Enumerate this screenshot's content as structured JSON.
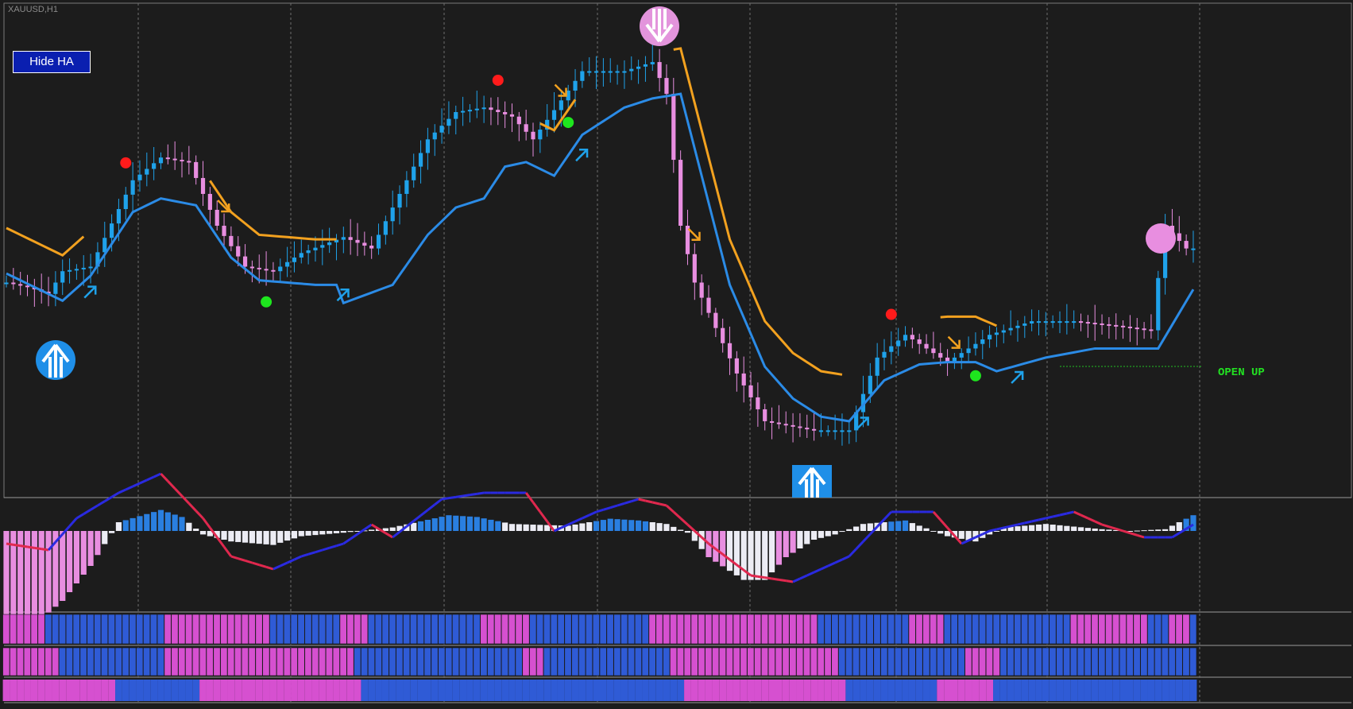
{
  "symbol_label": "XAUUSD,H1",
  "hide_button_label": "Hide HA",
  "open_label": "OPEN UP",
  "colors": {
    "background": "#1c1c1c",
    "grid": "#6e6e6e",
    "bull_candle": "#1fa2ea",
    "bear_candle": "#e88ee0",
    "trend_up_line": "#2b8be6",
    "trend_down_line": "#f2a11f",
    "signal_high_dot": "#ff1b1b",
    "signal_low_dot": "#1ee61e",
    "histo_blue": "#2a7fe0",
    "histo_white": "#ececf4",
    "histo_pink": "#e88ee0",
    "osc_blue": "#2a2ae0",
    "osc_red": "#e0284e",
    "strip_blue": "#2f5bd6",
    "strip_magenta": "#d650d0"
  },
  "icons": {
    "buy_circle": "up-arrow-circle-icon",
    "sell_circle": "down-arrow-circle-icon",
    "buy_square": "up-arrow-square-icon",
    "up_arrow": "diagonal-up-arrow-icon",
    "down_arrow": "diagonal-down-arrow-icon"
  },
  "chart_data": {
    "type": "candlestick",
    "title": "XAUUSD,H1",
    "bars": 170,
    "price_anchors": [
      [
        0,
        75
      ],
      [
        3,
        73
      ],
      [
        6,
        70
      ],
      [
        8,
        80
      ],
      [
        12,
        82
      ],
      [
        18,
        120
      ],
      [
        22,
        130
      ],
      [
        26,
        128
      ],
      [
        30,
        100
      ],
      [
        34,
        82
      ],
      [
        38,
        80
      ],
      [
        42,
        88
      ],
      [
        48,
        95
      ],
      [
        52,
        90
      ],
      [
        60,
        138
      ],
      [
        64,
        150
      ],
      [
        68,
        152
      ],
      [
        72,
        148
      ],
      [
        75,
        138
      ],
      [
        82,
        168
      ],
      [
        88,
        168
      ],
      [
        92,
        172
      ],
      [
        94,
        158
      ],
      [
        96,
        100
      ],
      [
        98,
        75
      ],
      [
        104,
        35
      ],
      [
        108,
        14
      ],
      [
        115,
        10
      ],
      [
        120,
        10
      ],
      [
        124,
        42
      ],
      [
        128,
        52
      ],
      [
        132,
        44
      ],
      [
        134,
        40
      ],
      [
        140,
        52
      ],
      [
        146,
        58
      ],
      [
        152,
        58
      ],
      [
        158,
        56
      ],
      [
        163,
        54
      ],
      [
        165,
        100
      ],
      [
        168,
        90
      ]
    ],
    "trend_anchors": [
      [
        0,
        85
      ],
      [
        8,
        73
      ],
      [
        12,
        84
      ],
      [
        18,
        112
      ],
      [
        22,
        118
      ],
      [
        27,
        115
      ],
      [
        32,
        92
      ],
      [
        36,
        82
      ],
      [
        44,
        80
      ],
      [
        47,
        80
      ],
      [
        48,
        72
      ],
      [
        55,
        80
      ],
      [
        60,
        102
      ],
      [
        64,
        114
      ],
      [
        68,
        118
      ],
      [
        71,
        132
      ],
      [
        74,
        134
      ],
      [
        78,
        128
      ],
      [
        82,
        146
      ],
      [
        88,
        158
      ],
      [
        92,
        162
      ],
      [
        96,
        164
      ],
      [
        98,
        140
      ],
      [
        103,
        80
      ],
      [
        108,
        44
      ],
      [
        112,
        30
      ],
      [
        116,
        22
      ],
      [
        120,
        20
      ],
      [
        125,
        38
      ],
      [
        130,
        45
      ],
      [
        134,
        46
      ],
      [
        138,
        46
      ],
      [
        141,
        42
      ],
      [
        148,
        48
      ],
      [
        155,
        52
      ],
      [
        164,
        52
      ],
      [
        169,
        78
      ]
    ],
    "trend_down_ranges": [
      [
        0,
        11
      ],
      [
        29,
        47
      ],
      [
        76,
        81
      ],
      [
        95,
        119
      ],
      [
        133,
        141
      ]
    ],
    "signals": {
      "buy_circles": [
        8
      ],
      "sell_circles": [
        94
      ],
      "buy_squares": [
        116
      ],
      "up_arrows": [
        11,
        47,
        81,
        121,
        143
      ],
      "down_arrows": [
        30,
        78,
        97,
        134
      ],
      "high_dots": [
        17,
        70,
        126
      ],
      "low_dots": [
        37,
        80,
        138
      ],
      "pink_dot": [
        167
      ]
    },
    "oscillator": {
      "histogram_anchors": [
        [
          0,
          -5
        ],
        [
          5,
          -5
        ],
        [
          8,
          -4
        ],
        [
          12,
          -2
        ],
        [
          16,
          0.5
        ],
        [
          22,
          1.2
        ],
        [
          25,
          0.8
        ],
        [
          28,
          -0.2
        ],
        [
          32,
          -0.6
        ],
        [
          38,
          -0.8
        ],
        [
          42,
          -0.3
        ],
        [
          48,
          -0.1
        ],
        [
          55,
          0.2
        ],
        [
          63,
          0.9
        ],
        [
          67,
          0.8
        ],
        [
          72,
          0.4
        ],
        [
          80,
          0.3
        ],
        [
          86,
          0.7
        ],
        [
          90,
          0.6
        ],
        [
          94,
          0.4
        ],
        [
          97,
          -0.1
        ],
        [
          100,
          -1.5
        ],
        [
          105,
          -2.8
        ],
        [
          108,
          -2.8
        ],
        [
          111,
          -1.5
        ],
        [
          115,
          -0.5
        ],
        [
          118,
          -0.2
        ],
        [
          122,
          0.4
        ],
        [
          128,
          0.6
        ],
        [
          134,
          -0.3
        ],
        [
          138,
          -0.6
        ],
        [
          142,
          0.2
        ],
        [
          148,
          0.4
        ],
        [
          156,
          0.1
        ],
        [
          160,
          0
        ],
        [
          165,
          0.1
        ],
        [
          169,
          0.9
        ]
      ],
      "line_anchors": [
        [
          0,
          -0.2
        ],
        [
          6,
          -0.3
        ],
        [
          10,
          0.2
        ],
        [
          16,
          0.6
        ],
        [
          22,
          0.9
        ],
        [
          28,
          0.2
        ],
        [
          32,
          -0.4
        ],
        [
          38,
          -0.6
        ],
        [
          42,
          -0.4
        ],
        [
          48,
          -0.2
        ],
        [
          52,
          0.1
        ],
        [
          55,
          -0.1
        ],
        [
          62,
          0.5
        ],
        [
          68,
          0.6
        ],
        [
          74,
          0.6
        ],
        [
          78,
          0.0
        ],
        [
          84,
          0.3
        ],
        [
          90,
          0.5
        ],
        [
          94,
          0.4
        ],
        [
          100,
          -0.2
        ],
        [
          106,
          -0.7
        ],
        [
          112,
          -0.8
        ],
        [
          116,
          -0.6
        ],
        [
          120,
          -0.4
        ],
        [
          126,
          0.3
        ],
        [
          132,
          0.3
        ],
        [
          136,
          -0.2
        ],
        [
          140,
          0.0
        ],
        [
          148,
          0.2
        ],
        [
          152,
          0.3
        ],
        [
          156,
          0.1
        ],
        [
          162,
          -0.1
        ],
        [
          166,
          -0.1
        ],
        [
          169,
          0.1
        ]
      ]
    },
    "strips": 3
  }
}
